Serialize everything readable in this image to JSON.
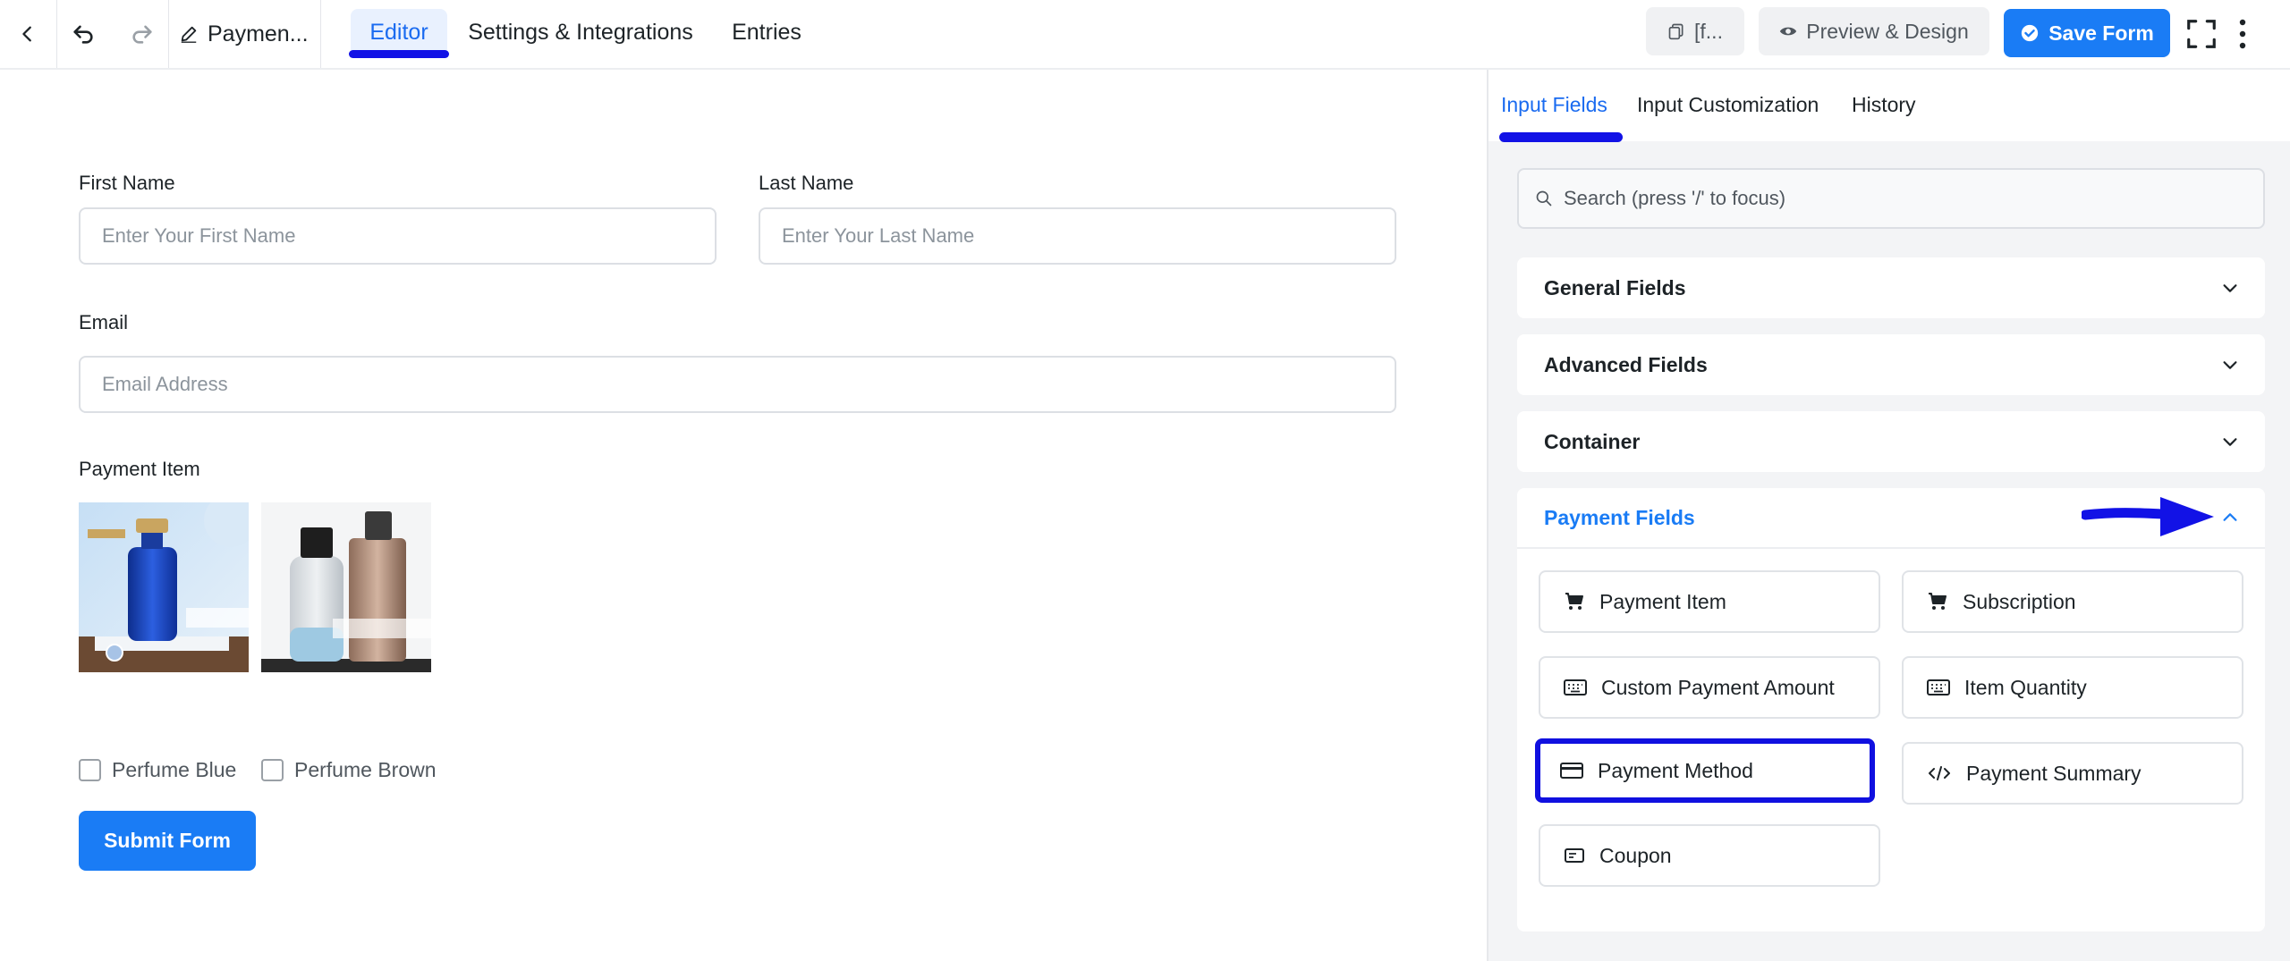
{
  "topbar": {
    "form_name": "Paymen...",
    "tabs": [
      {
        "label": "Editor",
        "active": true
      },
      {
        "label": "Settings & Integrations",
        "active": false
      },
      {
        "label": "Entries",
        "active": false
      }
    ],
    "shortcode_label": "[f...",
    "preview_label": "Preview & Design",
    "save_label": "Save Form"
  },
  "form": {
    "first_name": {
      "label": "First Name",
      "placeholder": "Enter Your First Name"
    },
    "last_name": {
      "label": "Last Name",
      "placeholder": "Enter Your Last Name"
    },
    "email": {
      "label": "Email",
      "placeholder": "Email Address"
    },
    "payment_item": {
      "label": "Payment Item",
      "options": [
        {
          "label": "Perfume Blue",
          "checked": false
        },
        {
          "label": "Perfume Brown",
          "checked": false
        }
      ]
    },
    "submit_label": "Submit Form"
  },
  "panel": {
    "tabs": [
      {
        "label": "Input Fields",
        "active": true
      },
      {
        "label": "Input Customization",
        "active": false
      },
      {
        "label": "History",
        "active": false
      }
    ],
    "search_placeholder": "Search (press '/' to focus)",
    "sections": [
      {
        "label": "General Fields",
        "expanded": false
      },
      {
        "label": "Advanced Fields",
        "expanded": false
      },
      {
        "label": "Container",
        "expanded": false
      },
      {
        "label": "Payment Fields",
        "expanded": true
      }
    ],
    "payment_fields": [
      {
        "label": "Payment Item",
        "icon": "cart-icon"
      },
      {
        "label": "Subscription",
        "icon": "cart-icon"
      },
      {
        "label": "Custom Payment Amount",
        "icon": "keyboard-icon"
      },
      {
        "label": "Item Quantity",
        "icon": "keyboard-icon"
      },
      {
        "label": "Payment Method",
        "icon": "credit-card-icon",
        "highlighted": true
      },
      {
        "label": "Payment Summary",
        "icon": "code-icon"
      },
      {
        "label": "Coupon",
        "icon": "coupon-icon"
      }
    ]
  },
  "colors": {
    "accent": "#1a7cf5",
    "annotation": "#1212e6"
  }
}
